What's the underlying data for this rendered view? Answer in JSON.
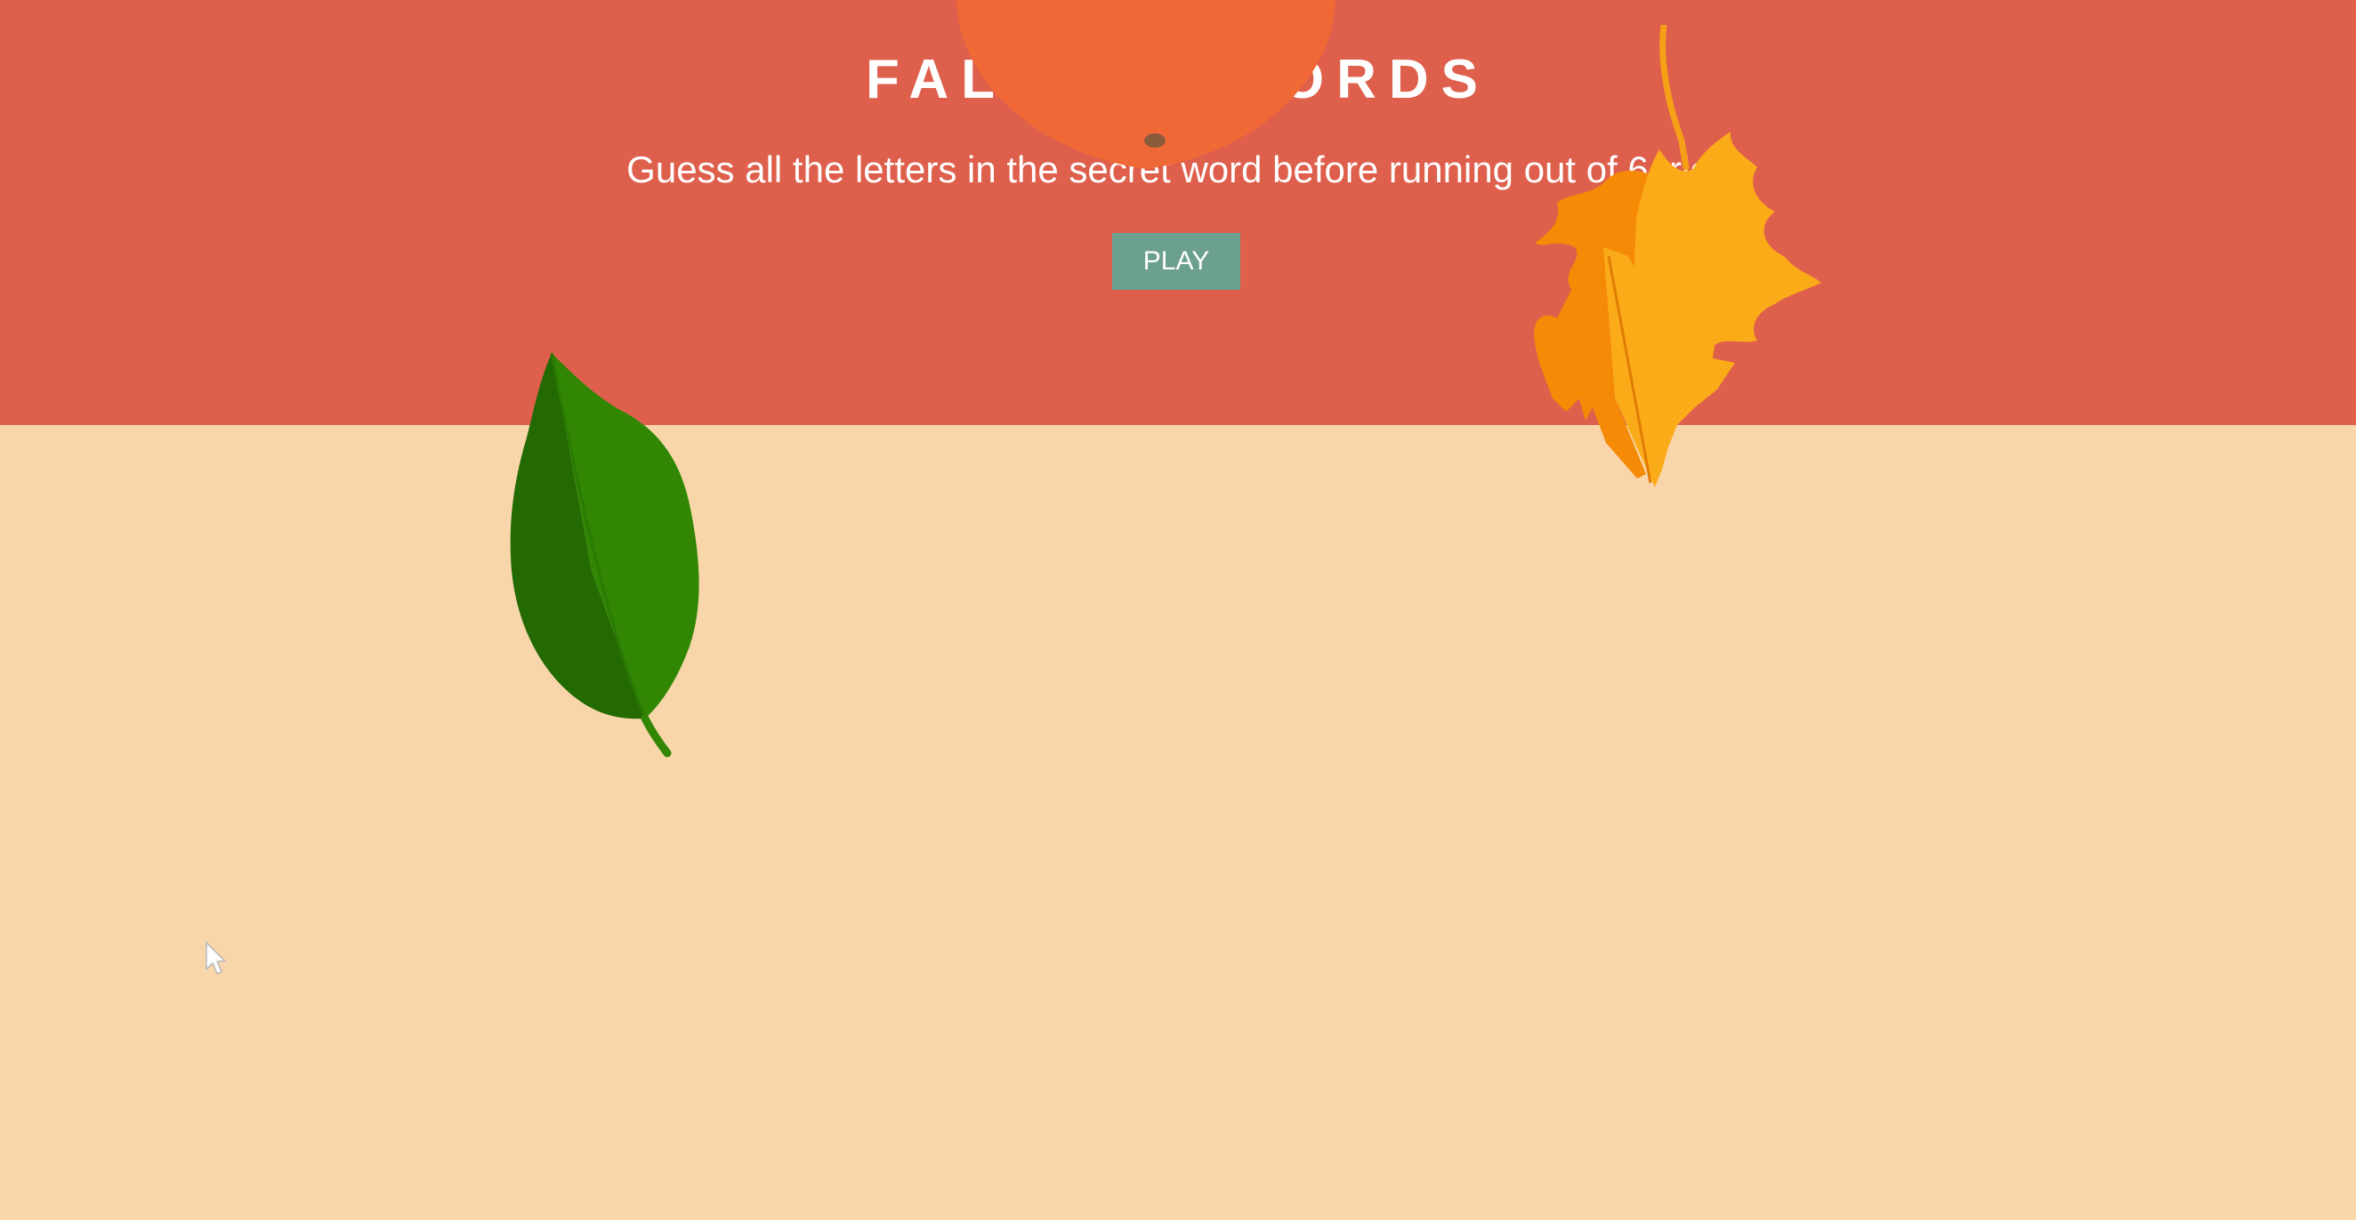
{
  "game": {
    "title": "FALLING WORDS",
    "instructions": "Guess all the letters in the secret word before running out of 6 tries",
    "play_label": "PLAY"
  },
  "colors": {
    "header_background": "#de5f4c",
    "body_background": "#f8d6aa",
    "play_button": "#6ba08f",
    "text": "#ffffff",
    "apple": "#f06836",
    "maple_leaf_dark": "#f58a07",
    "maple_leaf_light": "#fbab18",
    "green_leaf_dark": "#236a03",
    "green_leaf_light": "#318703"
  },
  "decorations": [
    "apple-icon",
    "maple-leaf-icon",
    "green-leaf-icon",
    "mouse-cursor-icon"
  ]
}
